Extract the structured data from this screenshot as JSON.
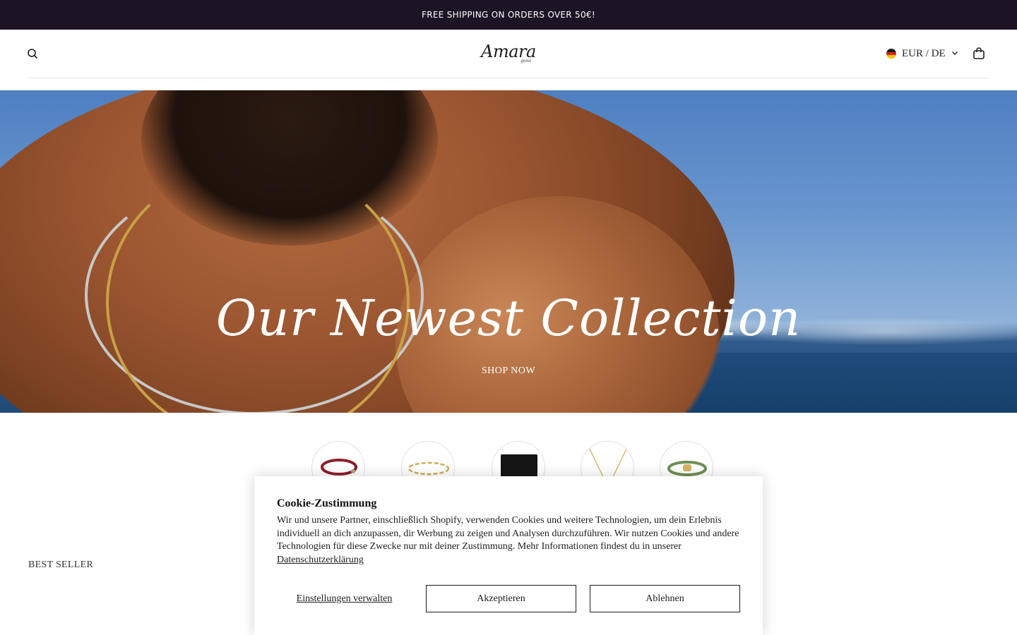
{
  "announcement": {
    "text": "FREE SHIPPING ON ORDERS OVER 50€!"
  },
  "header": {
    "search_icon": "search-icon",
    "logo": {
      "text": "Amara",
      "sub": "gioia"
    },
    "locale": {
      "label": "EUR / DE",
      "flag": "germany-flag",
      "chevron": "chevron-down-icon"
    },
    "cart_icon": "shopping-bag-icon"
  },
  "hero": {
    "title": "Our Newest Collection",
    "cta": "SHOP NOW"
  },
  "categories": [
    {
      "name": "red-cord-bracelet",
      "color": "#8b1f2b"
    },
    {
      "name": "gold-link-bracelet",
      "color": "#d2ac5a"
    },
    {
      "name": "black-card-holder",
      "color": "#151515"
    },
    {
      "name": "gold-necklace",
      "color": "#d8b46a"
    },
    {
      "name": "green-cord-bracelet",
      "color": "#6f8f55"
    }
  ],
  "sections": {
    "best_seller": "BEST SELLER"
  },
  "cookie": {
    "title": "Cookie-Zustimmung",
    "body": "Wir und unsere Partner, einschließlich Shopify, verwenden Cookies und weitere Technologien, um dein Erlebnis individuell an dich anzupassen, dir Werbung zu zeigen und Analysen durchzuführen. Wir nutzen Cookies und andere Technologien für diese Zwecke nur mit deiner Zustimmung. Mehr Informationen findest du in unserer ",
    "privacy_link": "Datenschutzerklärung",
    "manage": "Einstellungen verwalten",
    "accept": "Akzeptieren",
    "decline": "Ablehnen"
  }
}
